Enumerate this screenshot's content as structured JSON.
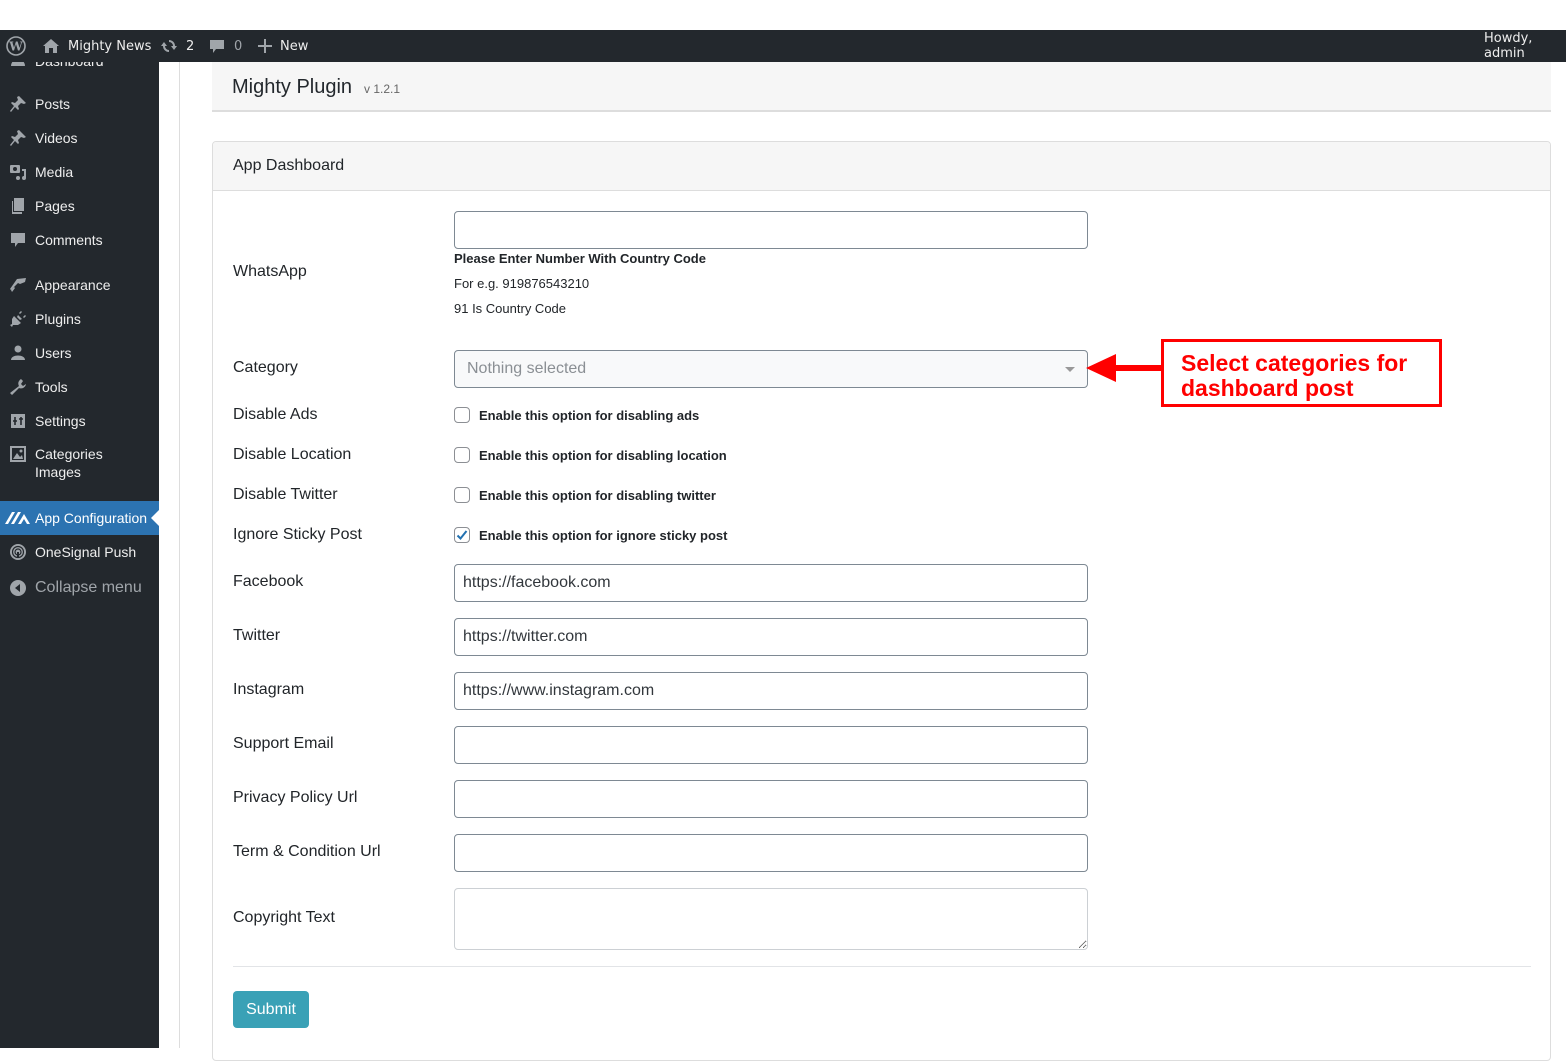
{
  "admin_bar": {
    "site_name": "Mighty News",
    "updates_count": "2",
    "comments_count": "0",
    "new_label": "New",
    "greeting": "Howdy, admin"
  },
  "sidebar": {
    "items": [
      {
        "label": "Dashboard",
        "icon": "dashboard-icon"
      },
      {
        "label": "Posts",
        "icon": "pin-icon"
      },
      {
        "label": "Videos",
        "icon": "pin-icon"
      },
      {
        "label": "Media",
        "icon": "media-icon"
      },
      {
        "label": "Pages",
        "icon": "pages-icon"
      },
      {
        "label": "Comments",
        "icon": "comment-icon"
      },
      {
        "label": "Appearance",
        "icon": "paintbrush-icon"
      },
      {
        "label": "Plugins",
        "icon": "plugin-icon"
      },
      {
        "label": "Users",
        "icon": "user-icon"
      },
      {
        "label": "Tools",
        "icon": "wrench-icon"
      },
      {
        "label": "Settings",
        "icon": "settings-icon"
      },
      {
        "label": "Categories Images",
        "icon": "image-icon"
      },
      {
        "label": "App Configuration",
        "icon": "mighty-logo-icon",
        "active": true
      },
      {
        "label": "OneSignal Push",
        "icon": "onesignal-icon"
      },
      {
        "label": "Collapse menu",
        "icon": "collapse-icon"
      }
    ]
  },
  "plugin": {
    "title": "Mighty Plugin",
    "version": "v 1.2.1"
  },
  "card": {
    "title": "App Dashboard"
  },
  "form": {
    "whatsapp": {
      "label": "WhatsApp",
      "value": "",
      "help_bold": "Please Enter Number With Country Code",
      "help_example": "For e.g. 919876543210",
      "help_code": "91 Is Country Code"
    },
    "category": {
      "label": "Category",
      "selected": "Nothing selected"
    },
    "disable_ads": {
      "label": "Disable Ads",
      "option": "Enable this option for disabling ads",
      "checked": false
    },
    "disable_location": {
      "label": "Disable Location",
      "option": "Enable this option for disabling location",
      "checked": false
    },
    "disable_twitter": {
      "label": "Disable Twitter",
      "option": "Enable this option for disabling twitter",
      "checked": false
    },
    "ignore_sticky": {
      "label": "Ignore Sticky Post",
      "option": "Enable this option for ignore sticky post",
      "checked": true
    },
    "facebook": {
      "label": "Facebook",
      "value": "https://facebook.com"
    },
    "twitter": {
      "label": "Twitter",
      "value": "https://twitter.com"
    },
    "instagram": {
      "label": "Instagram",
      "value": "https://www.instagram.com"
    },
    "support_email": {
      "label": "Support Email",
      "value": ""
    },
    "privacy_policy": {
      "label": "Privacy Policy Url",
      "value": ""
    },
    "terms": {
      "label": "Term & Condition Url",
      "value": ""
    },
    "copyright": {
      "label": "Copyright Text",
      "value": ""
    },
    "submit_label": "Submit"
  },
  "annotation": {
    "line1": "Select categories for",
    "line2": "dashboard post",
    "color": "#ff0000"
  }
}
